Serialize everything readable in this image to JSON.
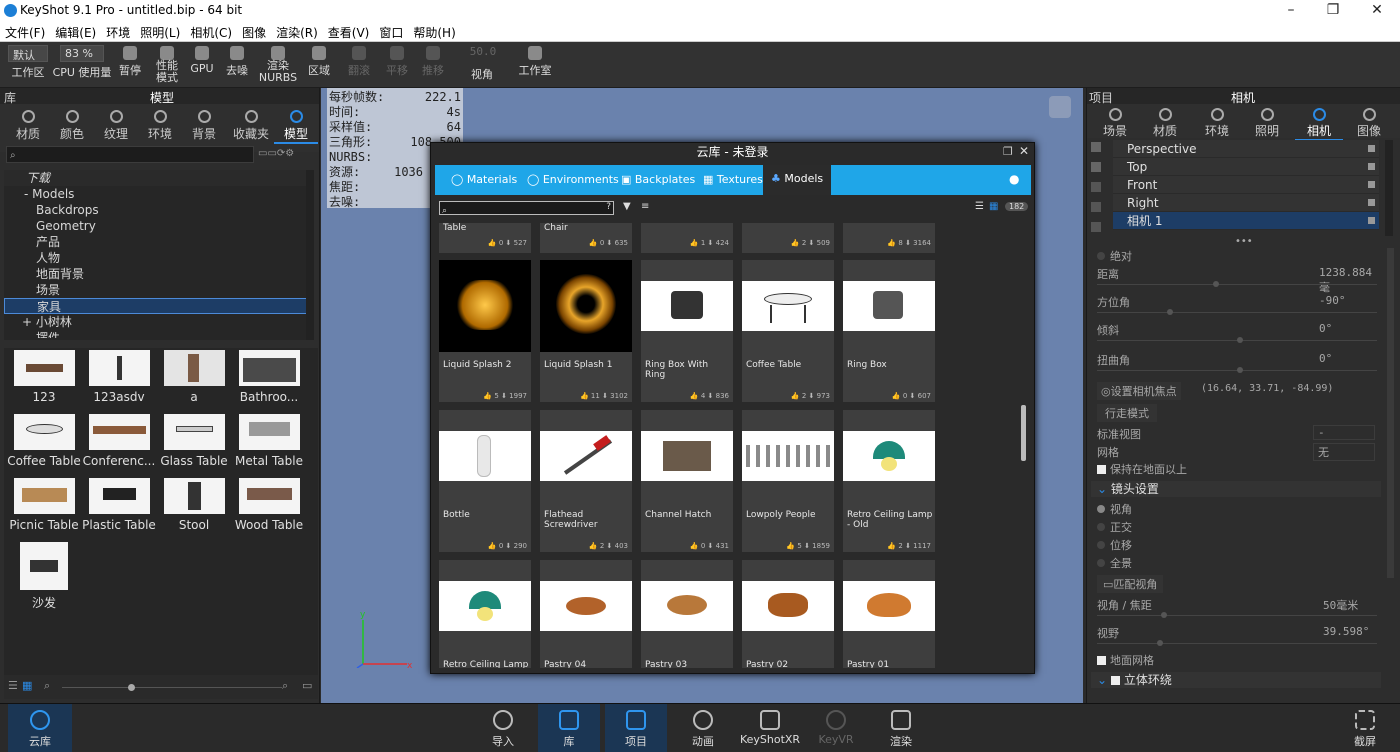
{
  "window": {
    "title": "KeyShot 9.1 Pro  - untitled.bip  - 64 bit"
  },
  "menu": [
    "文件(F)",
    "编辑(E)",
    "环境",
    "照明(L)",
    "相机(C)",
    "图像",
    "渲染(R)",
    "查看(V)",
    "窗口",
    "帮助(H)"
  ],
  "toolbar": {
    "workspace_value": "默认",
    "workspace_label": "工作区",
    "cpu_value": "83 %",
    "cpu_label": "CPU 使用量",
    "pause": "暂停",
    "perf_mode": "性能\n模式",
    "gpu": "GPU",
    "denoise": "去噪",
    "render_nurbs": "渲染\nNURBS",
    "region": "区域",
    "tumble": "翻滚",
    "pan": "平移",
    "dolly": "推移",
    "fov_value": "50.0",
    "fov_label": "视角",
    "studio": "工作室"
  },
  "left_panel": {
    "title_left": "库",
    "title_center": "模型",
    "tabs": [
      "材质",
      "颜色",
      "纹理",
      "环境",
      "背景",
      "收藏夹",
      "模型"
    ],
    "tree": [
      "下载",
      "Models",
      "Backdrops",
      "Geometry",
      "产品",
      "人物",
      "地面背景",
      "场景",
      "家具",
      "小树林",
      "摆件"
    ],
    "thumbnails": [
      "123",
      "123asdv",
      "a",
      "Bathroo...",
      "Coffee Table",
      "Conferenc...",
      "Glass Table",
      "Metal Table",
      "Picnic Table",
      "Plastic Table",
      "Stool",
      "Wood Table",
      "沙发"
    ]
  },
  "stats": {
    "rows": [
      {
        "label": "每秒帧数:",
        "value": "222.1"
      },
      {
        "label": "时间:",
        "value": "4s"
      },
      {
        "label": "采样值:",
        "value": "64"
      },
      {
        "label": "三角形:",
        "value": "108,500"
      },
      {
        "label": "NURBS:",
        "value": ""
      },
      {
        "label": "资源:",
        "value": "1036"
      },
      {
        "label": "焦距:",
        "value": ""
      },
      {
        "label": "去噪:",
        "value": ""
      }
    ]
  },
  "cloud": {
    "title": "云库 - 未登录",
    "tabs": [
      "Materials",
      "Environments",
      "Backplates",
      "Textures",
      "Models"
    ],
    "count": "182",
    "row0": [
      {
        "name": "Table",
        "likes": "0",
        "downloads": "527"
      },
      {
        "name": "Chair",
        "likes": "0",
        "downloads": "635"
      },
      {
        "name": "",
        "likes": "1",
        "downloads": "424"
      },
      {
        "name": "",
        "likes": "2",
        "downloads": "509"
      },
      {
        "name": "",
        "likes": "8",
        "downloads": "3164"
      }
    ],
    "row1": [
      {
        "name": "Liquid Splash 2",
        "likes": "5",
        "downloads": "1997"
      },
      {
        "name": "Liquid Splash 1",
        "likes": "11",
        "downloads": "3102"
      },
      {
        "name": "Ring Box With Ring",
        "likes": "4",
        "downloads": "836"
      },
      {
        "name": "Coffee Table",
        "likes": "2",
        "downloads": "973"
      },
      {
        "name": "Ring Box",
        "likes": "0",
        "downloads": "607"
      }
    ],
    "row2": [
      {
        "name": "Bottle",
        "likes": "0",
        "downloads": "290"
      },
      {
        "name": "Flathead Screwdriver",
        "likes": "2",
        "downloads": "403"
      },
      {
        "name": "Channel Hatch",
        "likes": "0",
        "downloads": "431"
      },
      {
        "name": "Lowpoly People",
        "likes": "5",
        "downloads": "1859"
      },
      {
        "name": "Retro Ceiling Lamp - Old",
        "likes": "2",
        "downloads": "1117"
      }
    ],
    "row3": [
      {
        "name": "Retro Ceiling Lamp"
      },
      {
        "name": "Pastry 04"
      },
      {
        "name": "Pastry 03"
      },
      {
        "name": "Pastry 02"
      },
      {
        "name": "Pastry 01"
      }
    ]
  },
  "right_panel": {
    "title_left": "项目",
    "title_center": "相机",
    "tabs": [
      "场景",
      "材质",
      "环境",
      "照明",
      "相机",
      "图像"
    ],
    "cameras": [
      "Perspective",
      "Top",
      "Front",
      "Right",
      "相机 1"
    ],
    "absolute": "绝对",
    "distance_label": "距离",
    "distance_value": "1238.884毫",
    "azimuth_label": "方位角",
    "azimuth_value": "-90°",
    "incline_label": "倾斜",
    "incline_value": "0°",
    "twist_label": "扭曲角",
    "twist_value": "0°",
    "set_focus": "设置相机焦点",
    "focus_coords": "(16.64, 33.71, -84.99)",
    "walk_mode": "行走模式",
    "std_view_label": "标准视图",
    "std_view_value": "-",
    "grid_label": "网格",
    "grid_value": "无",
    "keep_ground": "保持在地面以上",
    "lens_section": "镜头设置",
    "lens_options": [
      "视角",
      "正交",
      "位移",
      "全景"
    ],
    "match_view": "匹配视角",
    "fov_focal_label": "视角 / 焦距",
    "fov_focal_value": "50毫米",
    "fov_label": "视野",
    "fov_value": "39.598°",
    "ground_grid": "地面网格",
    "stereo_section": "立体环绕"
  },
  "dock": [
    "云库",
    "导入",
    "库",
    "项目",
    "动画",
    "KeyShotXR",
    "KeyVR",
    "渲染",
    "截屏"
  ]
}
